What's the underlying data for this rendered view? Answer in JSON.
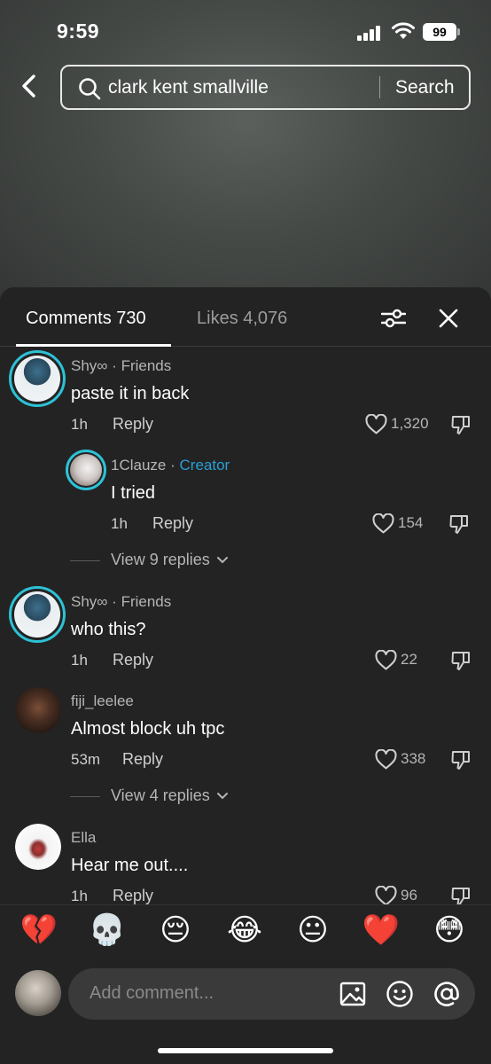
{
  "status": {
    "time": "9:59",
    "battery": "99"
  },
  "search": {
    "query": "clark kent smallville",
    "button": "Search"
  },
  "tabs": {
    "comments": "Comments 730",
    "likes": "Likes 4,076"
  },
  "comments": [
    {
      "user": "Shy∞",
      "tag": "Friends",
      "text": "paste it in back",
      "time": "1h",
      "reply": "Reply",
      "likes": "1,320"
    },
    {
      "user": "1Clauze",
      "tag": "Creator",
      "text": "I tried",
      "time": "1h",
      "reply": "Reply",
      "likes": "154",
      "view_replies": "View 9 replies"
    },
    {
      "user": "Shy∞",
      "tag": "Friends",
      "text": "who this?",
      "time": "1h",
      "reply": "Reply",
      "likes": "22"
    },
    {
      "user": "fiji_leelee",
      "text": "Almost block uh tpc",
      "time": "53m",
      "reply": "Reply",
      "likes": "338",
      "view_replies": "View 4 replies"
    },
    {
      "user": "Ella",
      "text": "Hear me out....",
      "time": "1h",
      "reply": "Reply",
      "likes": "96"
    }
  ],
  "emojis": [
    "💔",
    "💀",
    "😔",
    "😂",
    "😐",
    "❤️",
    "😳"
  ],
  "input": {
    "placeholder": "Add comment..."
  },
  "colors": {
    "ring": "#2dc2d6",
    "creator": "#2a9fd6",
    "panel": "#232323"
  }
}
